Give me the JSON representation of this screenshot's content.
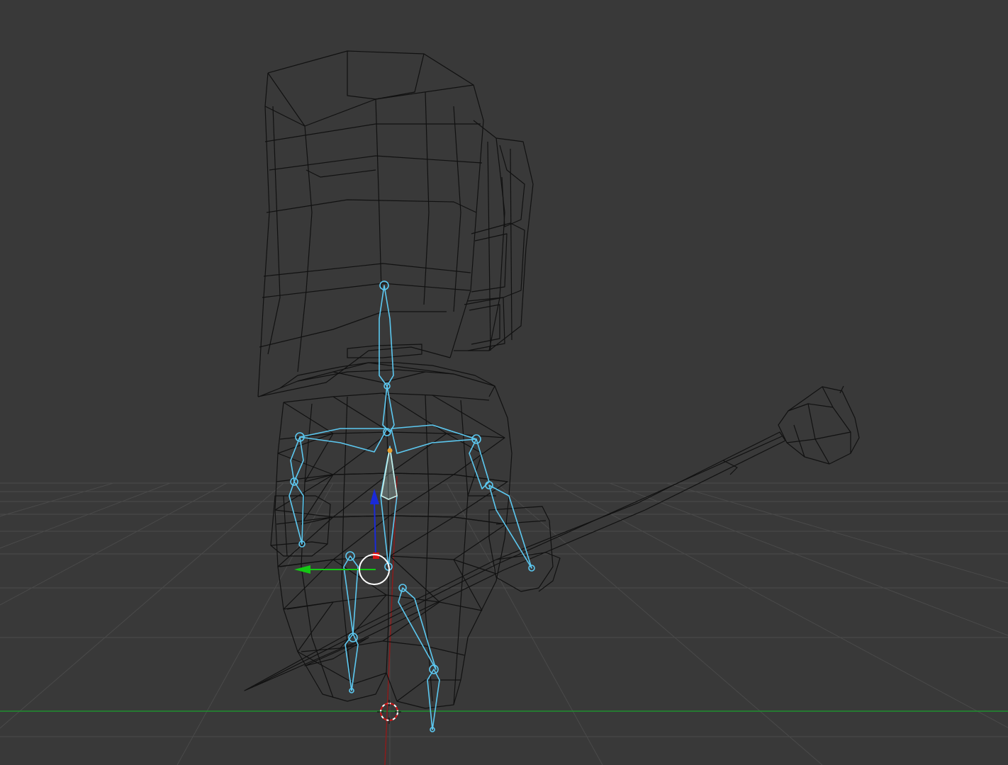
{
  "viewport": {
    "mode": "wireframe",
    "background_color": "#393939",
    "grid_color": "#4a4a4a",
    "x_axis_color": "#1f8f2f",
    "z_axis_color": "#8a1c1c",
    "mesh_wire_color": "#111111",
    "armature_color": "#5cc8f0",
    "active_bone_color": "#c8f0e8"
  },
  "gizmo": {
    "z_handle_color": "#1a2ad8",
    "y_handle_color": "#14c814",
    "x_handle_color": "#d81414",
    "pivot_ring_color": "#ffffff"
  },
  "cursor_3d": {
    "icon": "3d-cursor-icon"
  },
  "selection": {
    "pivot_point_color": "#e8a030"
  }
}
